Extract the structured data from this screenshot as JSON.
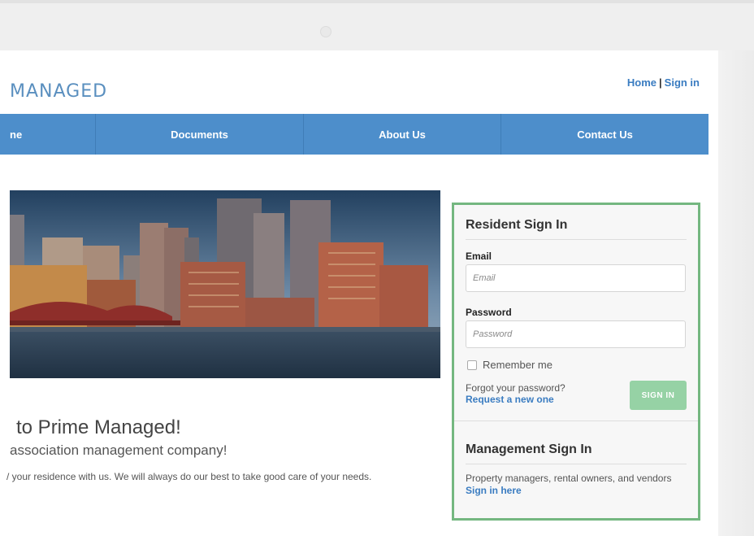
{
  "header": {
    "logo_text": "MANAGED",
    "home_link": "Home",
    "separator": "|",
    "signin_link": "Sign in"
  },
  "nav": {
    "items": [
      {
        "label": "ne"
      },
      {
        "label": "Documents"
      },
      {
        "label": "About Us"
      },
      {
        "label": "Contact Us"
      }
    ]
  },
  "main": {
    "welcome": "to Prime Managed!",
    "tagline": "association management company!",
    "blurb": "/ your residence with us. We will always do our best to take good care of your needs."
  },
  "resident_signin": {
    "title": "Resident Sign In",
    "email_label": "Email",
    "email_placeholder": "Email",
    "email_value": "",
    "password_label": "Password",
    "password_placeholder": "Password",
    "password_value": "",
    "remember_label": "Remember me",
    "remember_checked": false,
    "forgot_text": "Forgot your password?",
    "request_link": "Request a new one",
    "signin_button": "SIGN IN"
  },
  "management_signin": {
    "title": "Management Sign In",
    "description": "Property managers, rental owners, and vendors",
    "link": "Sign in here"
  },
  "colors": {
    "nav_bg": "#4d8ecb",
    "link_blue": "#3a7cc1",
    "panel_border": "#74b780",
    "signin_button": "#96d2a5"
  }
}
